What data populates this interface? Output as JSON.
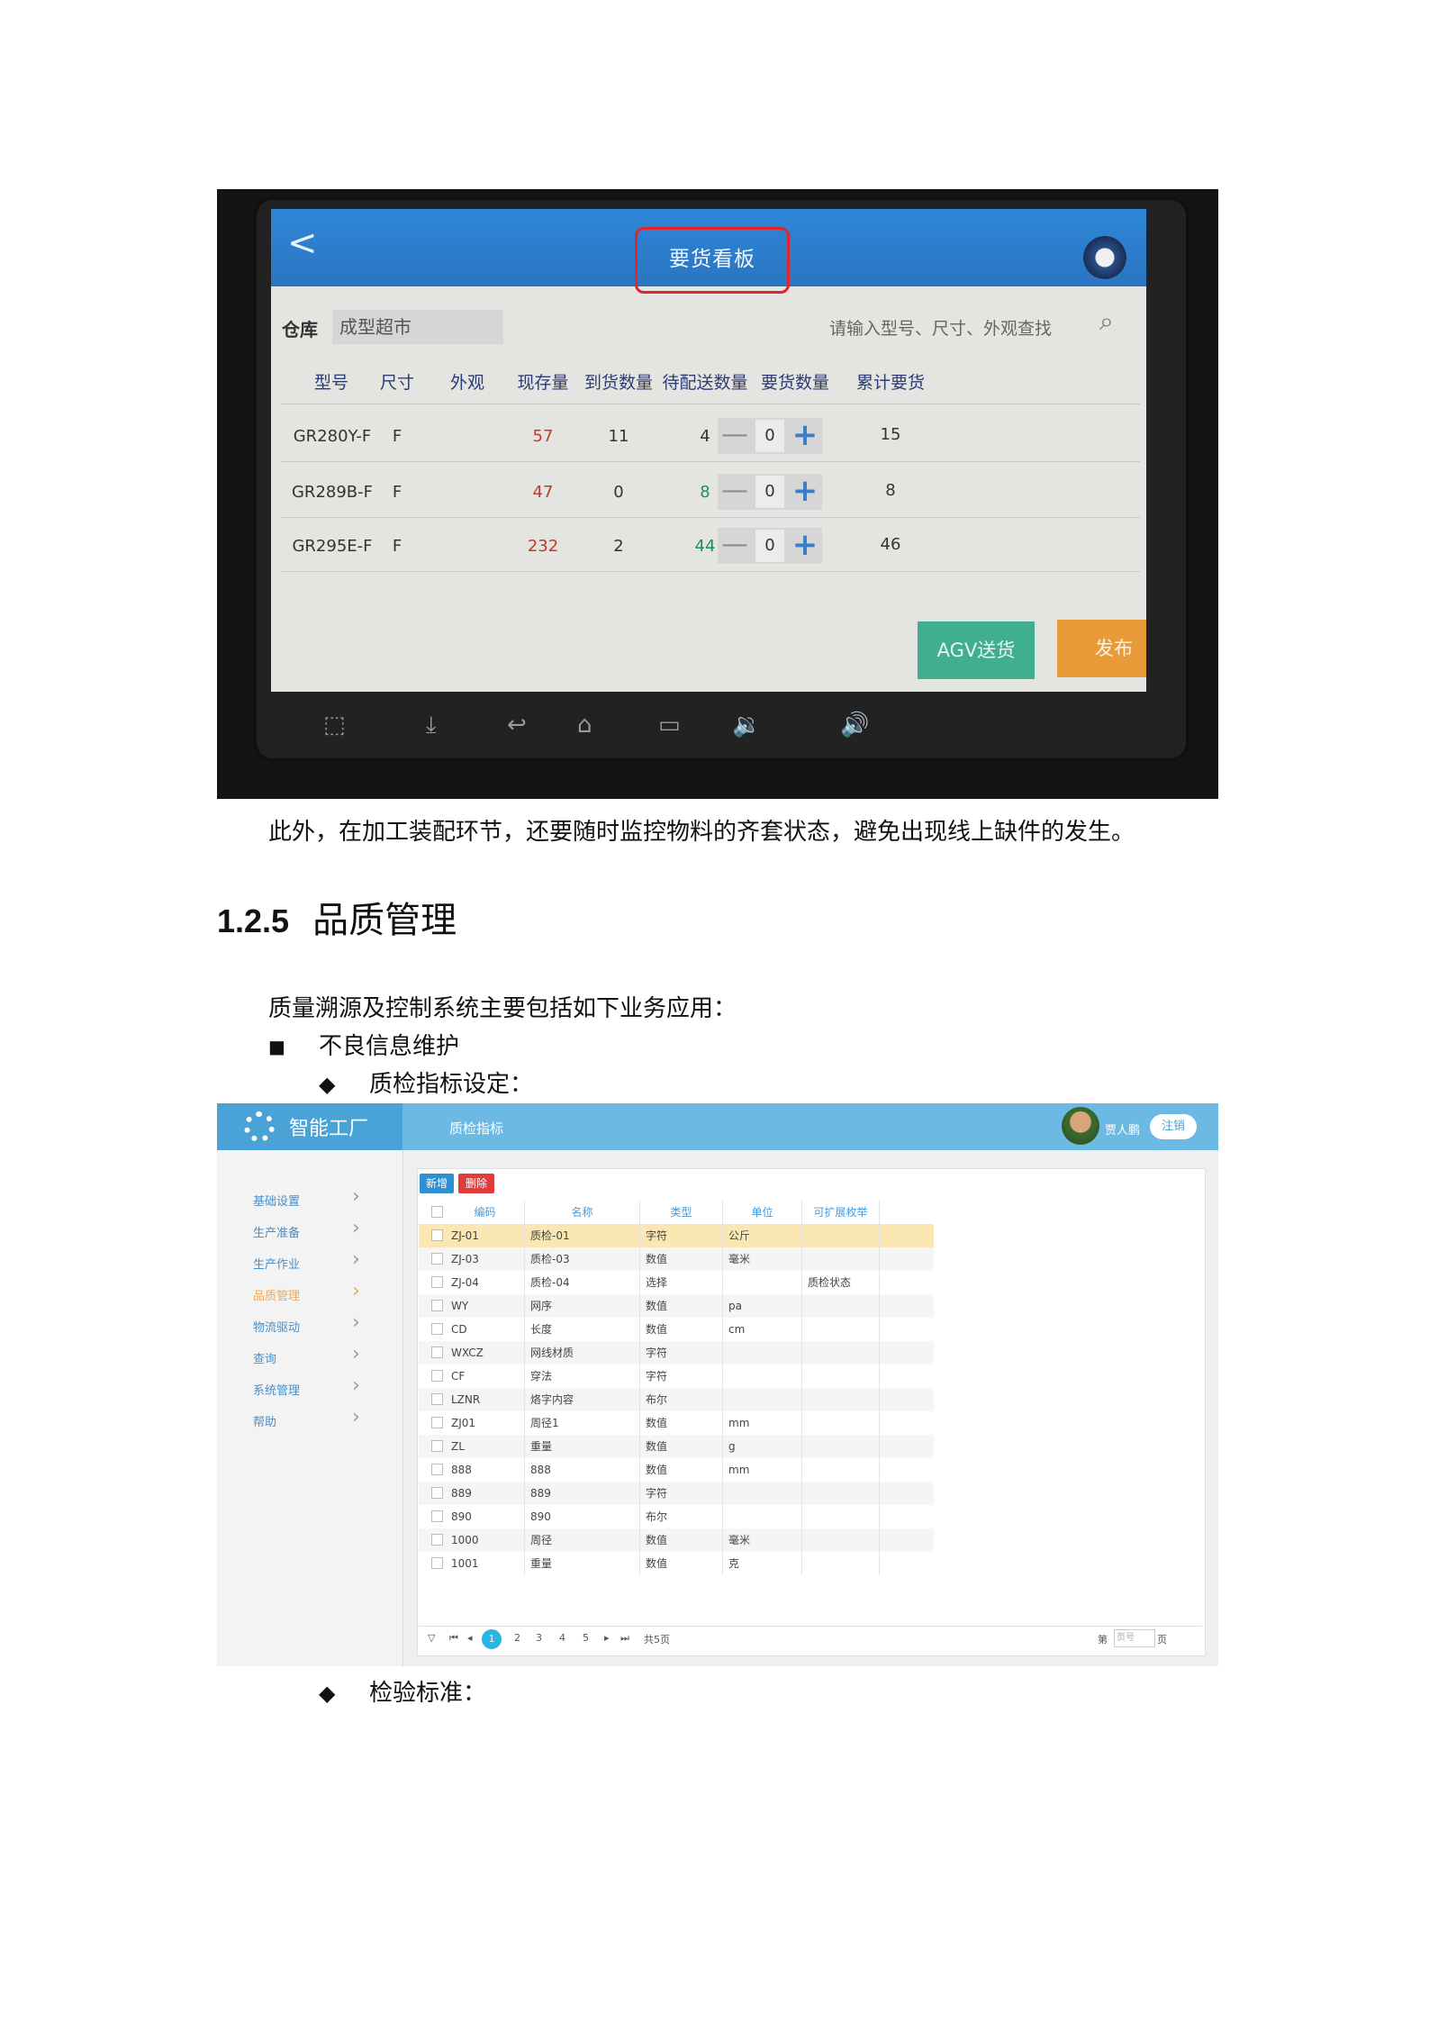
{
  "tablet": {
    "back": "<",
    "title": "要货看板",
    "warehouse_label": "仓库",
    "warehouse_value": "成型超市",
    "search_placeholder": "请输入型号、尺寸、外观查找",
    "columns": [
      "型号",
      "尺寸",
      "外观",
      "现存量",
      "到货数量",
      "待配送数量",
      "要货数量",
      "累计要货"
    ],
    "rows": [
      {
        "model": "GR280Y-F",
        "size": "F",
        "look": "",
        "stock": "57",
        "arrived": "11",
        "pending": "4",
        "qty": "0",
        "total": "15"
      },
      {
        "model": "GR289B-F",
        "size": "F",
        "look": "",
        "stock": "47",
        "arrived": "0",
        "pending": "8",
        "qty": "0",
        "total": "8"
      },
      {
        "model": "GR295E-F",
        "size": "F",
        "look": "",
        "stock": "232",
        "arrived": "2",
        "pending": "44",
        "qty": "0",
        "total": "46"
      }
    ],
    "minus": "—",
    "plus": "+",
    "agv_button": "AGV送货",
    "publish_button": "发布"
  },
  "text": {
    "para1": "此外，在加工装配环节，还要随时监控物料的齐套状态，避免出现线上缺件的发生。",
    "heading_num": "1.2.5",
    "heading_text": "品质管理",
    "para2": "质量溯源及控制系统主要包括如下业务应用：",
    "bullet_square": "■",
    "bullet1": "不良信息维护",
    "bullet_diamond": "◆",
    "sub1": "质检指标设定：",
    "sub2": "检验标准："
  },
  "app": {
    "brand": "智能工厂",
    "tab": "质检指标",
    "user": "贾人鹏",
    "logout": "注销",
    "menu": [
      "基础设置",
      "生产准备",
      "生产作业",
      "品质管理",
      "物流驱动",
      "查询",
      "系统管理",
      "帮助"
    ],
    "active_menu": "品质管理",
    "add_button": "新增",
    "delete_button": "删除",
    "table_headers": [
      "编码",
      "名称",
      "类型",
      "单位",
      "可扩展枚举"
    ],
    "table_rows": [
      [
        "ZJ-01",
        "质检-01",
        "字符",
        "公斤",
        ""
      ],
      [
        "ZJ-03",
        "质检-03",
        "数值",
        "毫米",
        ""
      ],
      [
        "ZJ-04",
        "质检-04",
        "选择",
        "",
        "质检状态"
      ],
      [
        "WY",
        "网序",
        "数值",
        "pa",
        ""
      ],
      [
        "CD",
        "长度",
        "数值",
        "cm",
        ""
      ],
      [
        "WXCZ",
        "网线材质",
        "字符",
        "",
        ""
      ],
      [
        "CF",
        "穿法",
        "字符",
        "",
        ""
      ],
      [
        "LZNR",
        "烙字内容",
        "布尔",
        "",
        ""
      ],
      [
        "ZJ01",
        "周径1",
        "数值",
        "mm",
        ""
      ],
      [
        "ZL",
        "重量",
        "数值",
        "g",
        ""
      ],
      [
        "888",
        "888",
        "数值",
        "mm",
        ""
      ],
      [
        "889",
        "889",
        "字符",
        "",
        ""
      ],
      [
        "890",
        "890",
        "布尔",
        "",
        ""
      ],
      [
        "1000",
        "周径",
        "数值",
        "毫米",
        ""
      ],
      [
        "1001",
        "重量",
        "数值",
        "克",
        ""
      ]
    ],
    "pager": {
      "pages": [
        "1",
        "2",
        "3",
        "4",
        "5"
      ],
      "current": "1",
      "total": "共5页",
      "goto_prefix": "第",
      "goto_placeholder": "页号",
      "goto_suffix": "页"
    }
  }
}
